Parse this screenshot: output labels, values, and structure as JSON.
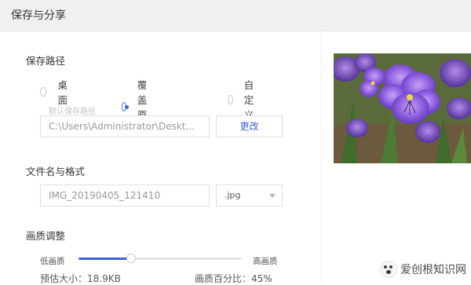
{
  "window": {
    "title": "保存与分享"
  },
  "save_path": {
    "section_title": "保存路径",
    "options": [
      {
        "label": "桌面",
        "checked": false
      },
      {
        "label": "覆盖原图",
        "checked": true
      },
      {
        "label": "自定义",
        "checked": false
      }
    ],
    "default_hint": "默认保存路径",
    "path_value": "C:\\Users\\Administrator\\Deskt...",
    "change_button": "更改"
  },
  "filename": {
    "section_title": "文件名与格式",
    "value": "IMG_20190405_121410",
    "format": ".jpg"
  },
  "quality": {
    "section_title": "画质调整",
    "low_label": "低画质",
    "high_label": "高画质",
    "level_fraction": 0.32,
    "estimated_size": "预估大小：18.9KB",
    "percent_text": "画质百分比：45%",
    "accent_color": "#3d62d9"
  },
  "preview": {
    "icon": "flower-photo"
  },
  "watermark": {
    "text": "爱创根知识网"
  }
}
